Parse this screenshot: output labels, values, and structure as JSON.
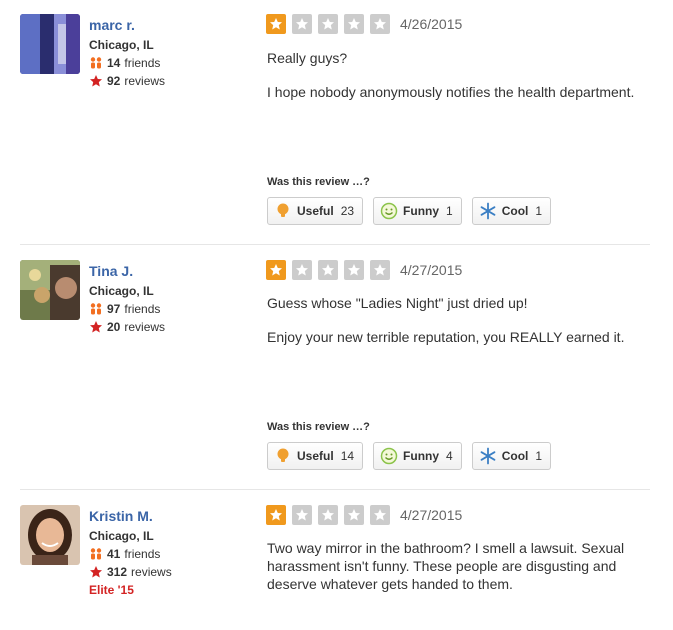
{
  "colors": {
    "accent_star": "#f0991d",
    "name_link": "#3b65a7",
    "elite": "#d32323"
  },
  "vote_prompt": "Was this review …?",
  "reviews": [
    {
      "user": {
        "name": "marc r.",
        "location": "Chicago, IL",
        "friends": "14",
        "friends_label": "friends",
        "reviews": "92",
        "reviews_label": "reviews"
      },
      "rating": 1,
      "date": "4/26/2015",
      "paragraphs": [
        "Really guys?",
        "I hope nobody anonymously notifies the health department."
      ],
      "votes": {
        "useful_label": "Useful",
        "useful_count": "23",
        "funny_label": "Funny",
        "funny_count": "1",
        "cool_label": "Cool",
        "cool_count": "1"
      }
    },
    {
      "user": {
        "name": "Tina J.",
        "location": "Chicago, IL",
        "friends": "97",
        "friends_label": "friends",
        "reviews": "20",
        "reviews_label": "reviews"
      },
      "rating": 1,
      "date": "4/27/2015",
      "paragraphs": [
        "Guess whose \"Ladies Night\" just dried up!",
        "Enjoy your new terrible reputation, you REALLY earned it."
      ],
      "votes": {
        "useful_label": "Useful",
        "useful_count": "14",
        "funny_label": "Funny",
        "funny_count": "4",
        "cool_label": "Cool",
        "cool_count": "1"
      }
    },
    {
      "user": {
        "name": "Kristin M.",
        "location": "Chicago, IL",
        "friends": "41",
        "friends_label": "friends",
        "reviews": "312",
        "reviews_label": "reviews",
        "elite": "Elite '15"
      },
      "rating": 1,
      "date": "4/27/2015",
      "paragraphs": [
        "Two way mirror in the bathroom? I smell a lawsuit.  Sexual harassment isn't funny.  These people are disgusting and deserve whatever gets handed to them."
      ]
    }
  ]
}
